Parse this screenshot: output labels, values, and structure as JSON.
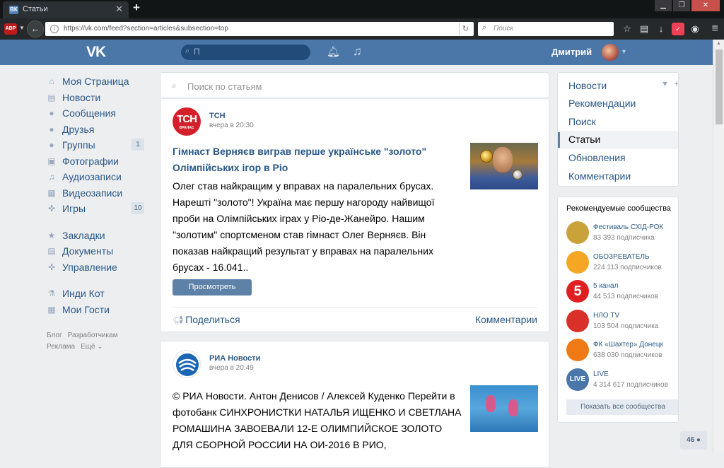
{
  "browser": {
    "tab_title": "Статьи",
    "tab_favicon": "ВК",
    "new_tab": "+",
    "abp": "ABP",
    "url": "https://vk.com/feed?section=articles&subsection=top",
    "search_placeholder": "Поиск"
  },
  "header": {
    "logo": "VK",
    "search_value": "П",
    "username": "Дмитрий"
  },
  "sidebar": {
    "items": [
      {
        "label": "Моя Страница",
        "icon": "home-icon",
        "glyph": "⌂"
      },
      {
        "label": "Новости",
        "icon": "news-icon",
        "glyph": "▤"
      },
      {
        "label": "Сообщения",
        "icon": "message-icon",
        "glyph": "●"
      },
      {
        "label": "Друзья",
        "icon": "friends-icon",
        "glyph": "●"
      },
      {
        "label": "Группы",
        "icon": "groups-icon",
        "glyph": "●",
        "badge": "1"
      },
      {
        "label": "Фотографии",
        "icon": "photo-icon",
        "glyph": "▣"
      },
      {
        "label": "Аудиозаписи",
        "icon": "music-icon",
        "glyph": "♫"
      },
      {
        "label": "Видеозаписи",
        "icon": "video-icon",
        "glyph": "▦"
      },
      {
        "label": "Игры",
        "icon": "games-icon",
        "glyph": "✜",
        "badge": "10"
      }
    ],
    "items2": [
      {
        "label": "Закладки",
        "icon": "bookmark-star-icon",
        "glyph": "★"
      },
      {
        "label": "Документы",
        "icon": "document-icon",
        "glyph": "▤"
      },
      {
        "label": "Управление",
        "icon": "manage-icon",
        "glyph": "✜"
      }
    ],
    "items3": [
      {
        "label": "Инди Кот",
        "icon": "flask-icon",
        "glyph": "⚗"
      },
      {
        "label": "Мои Гости",
        "icon": "apps-icon",
        "glyph": "▦"
      }
    ],
    "footer": [
      "Блог",
      "Разработчикам",
      "Реклама",
      "Ещё ⌄"
    ]
  },
  "feed": {
    "search_placeholder": "Поиск по статьям",
    "posts": [
      {
        "source": "ТСН",
        "avatar_text": "ТСН",
        "avatar_sub": "ВРАНАС",
        "time": "вчера в 20:30",
        "title": "Гімнаст Верняєв виграв перше українське \"золото\" Олімпійських ігор в Ріо",
        "text": "Олег став найкращим у вправах на паралельних брусах. Нарешті \"золото\"! Україна має першу нагороду найвищої проби на Олімпійських іграх у Ріо-де-Жанейро. Нашим \"золотим\" спортсменом став гімнаст Олег Верняєв. Він показав найкращий результат у вправах на паралельних брусах - 16.041..",
        "button": "Просмотреть",
        "share": "Поделиться",
        "comments": "Комментарии"
      },
      {
        "source": "РИА Новости",
        "time": "вчера в 20:49",
        "text": "© РИА Новости. Антон Денисов / Алексей Куденко Перейти в фотобанк СИНХРОНИСТКИ НАТАЛЬЯ ИЩЕНКО И СВЕТЛАНА РОМАШИНА ЗАВОЕВАЛИ 12-Е ОЛИМПИЙСКОЕ ЗОЛОТО ДЛЯ СБОРНОЙ РОССИИ НА ОИ-2016 В РИО,"
      }
    ]
  },
  "right_menu": {
    "items": [
      "Новости",
      "Рекомендации",
      "Поиск",
      "Статьи",
      "Обновления",
      "Комментарии"
    ],
    "active": "Статьи"
  },
  "communities": {
    "title": "Рекомендуемые сообщества",
    "items": [
      {
        "name": "Фестиваль СХІД-РОК",
        "subs": "83 393 подписчика",
        "color": "#c9a23a"
      },
      {
        "name": "ОБОЗРЕВАТЕЛЬ",
        "subs": "224 113 подписчиков",
        "color": "#f5a623"
      },
      {
        "name": "5 канал",
        "subs": "44 513 подписчиков",
        "color": "#e02020",
        "label": "5"
      },
      {
        "name": "НЛО TV",
        "subs": "103 504 подписчика",
        "color": "#d9302a"
      },
      {
        "name": "ФК «Шахтер» Донецк",
        "subs": "638 030 подписчиков",
        "color": "#f07b16"
      },
      {
        "name": "LIVE",
        "subs": "4 314 617 подписчиков",
        "color": "#4a76a8",
        "label": "LIVE"
      }
    ],
    "show_all": "Показать все сообщества"
  },
  "friends_counter": "46"
}
